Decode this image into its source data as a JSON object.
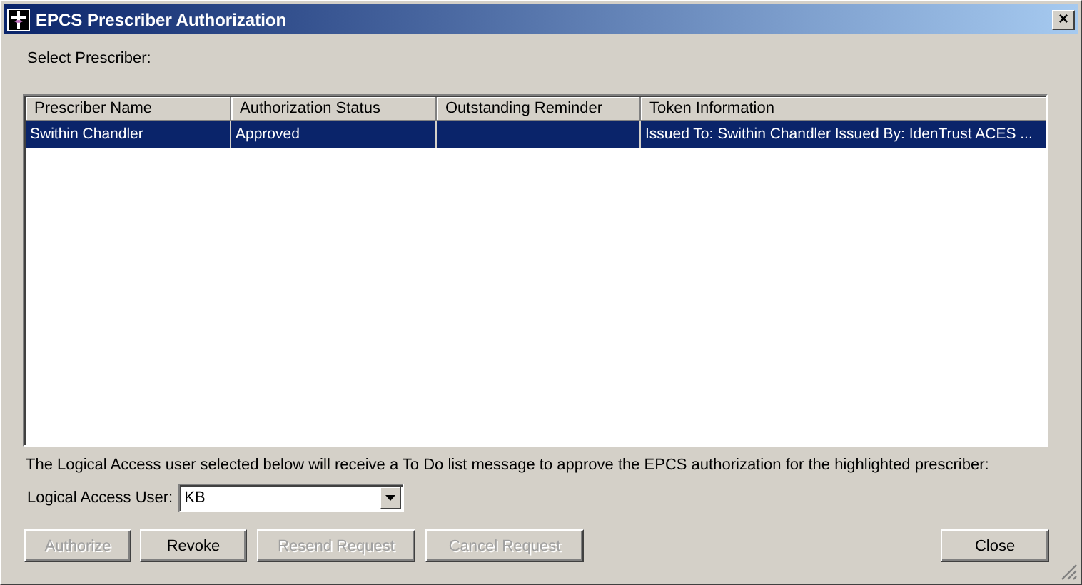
{
  "window": {
    "title": "EPCS Prescriber Authorization",
    "close": "×"
  },
  "prompt": "Select Prescriber:",
  "table": {
    "columns": [
      "Prescriber Name",
      "Authorization Status",
      "Outstanding Reminder",
      "Token Information"
    ],
    "rows": [
      {
        "cells": [
          "Swithin Chandler",
          "Approved",
          "",
          "Issued To: Swithin Chandler Issued By: IdenTrust ACES ..."
        ],
        "selected": true
      }
    ]
  },
  "note": "The Logical Access user selected below will receive a To Do list message to approve the EPCS authorization for the highlighted prescriber:",
  "user_field": {
    "label": "Logical Access User:",
    "value": "KB"
  },
  "buttons": [
    {
      "label": "Authorize",
      "disabled": true
    },
    {
      "label": "Revoke",
      "disabled": false
    },
    {
      "label": "Resend Request",
      "disabled": true
    },
    {
      "label": "Cancel Request",
      "disabled": true
    }
  ],
  "close_button": {
    "label": "Close",
    "disabled": false
  }
}
